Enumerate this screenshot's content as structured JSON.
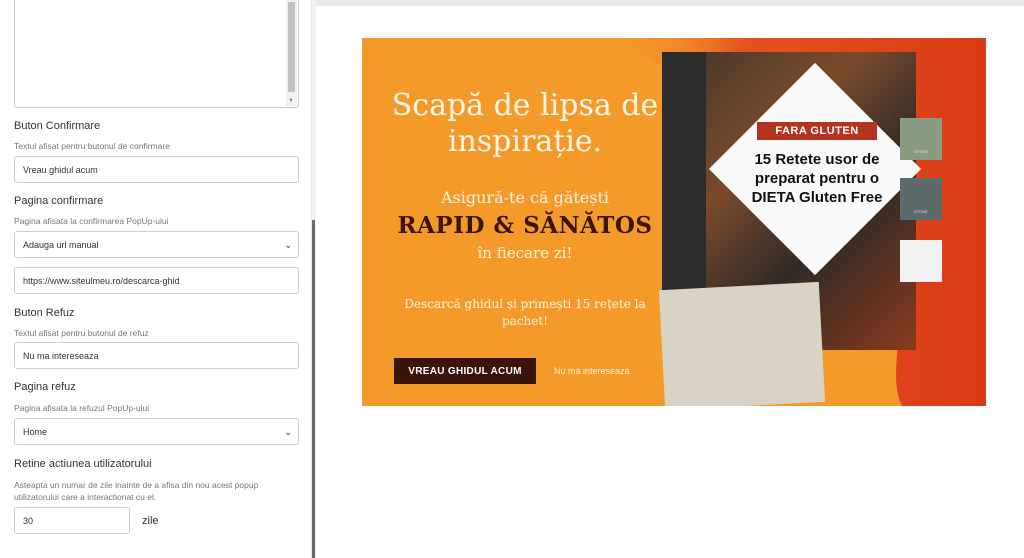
{
  "settings": {
    "confirm_button": {
      "label": "Buton Confirmare",
      "hint": "Textul afisat pentru butonul de confirmare",
      "value": "Vreau ghidul acum"
    },
    "confirm_page": {
      "label": "Pagina confirmare",
      "hint": "Pagina afisata la confirmarea PopUp-ului",
      "select_value": "Adauga url manual",
      "url_value": "https://www.siteulmeu.ro/descarca-ghid"
    },
    "refuse_button": {
      "label": "Buton Refuz",
      "hint": "Textul afisat pentru butonul de refuz",
      "value": "Nu ma intereseaza"
    },
    "refuse_page": {
      "label": "Pagina refuz",
      "hint": "Pagina afisata la refuzul PopUp-ului",
      "select_value": "Home"
    },
    "retain": {
      "label": "Retine actiunea utilizatorului",
      "hint": "Asteapta un numar de zile inainte de a afisa din nou acest popup utilizatorului care a interactionat cu el.",
      "days_value": "30",
      "unit": "zile"
    }
  },
  "banner": {
    "headline": "Scapă de lipsa de inspirație.",
    "line1": "Asigură-te că gătești",
    "line2": "RAPID & SĂNĂTOS",
    "line3": "în fiecare zi!",
    "line4": "Descarcă ghidul și primești 15 rețete la pachet!",
    "confirm_label": "VREAU GHIDUL ACUM",
    "refuse_label": "Nu ma intereseaza",
    "book": {
      "ribbon": "FARA GLUTEN",
      "title": "15 Retete usor de preparat pentru o DIETA Gluten Free"
    },
    "swatches": [
      {
        "color": "#8b9a83",
        "text": "GREEN"
      },
      {
        "color": "#5c6a6a",
        "text": "STONE"
      },
      {
        "color": "#f2f2f2",
        "text": ""
      }
    ],
    "colors": {
      "orange": "#f49a2b",
      "red": "#d9401a",
      "dark": "#3a1309"
    }
  }
}
